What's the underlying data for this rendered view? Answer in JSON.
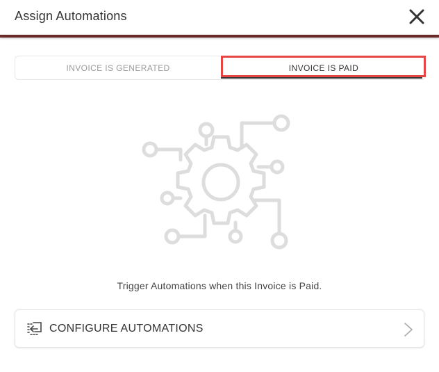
{
  "header": {
    "title": "Assign Automations",
    "close_icon": "close-icon"
  },
  "tabs": [
    {
      "label": "INVOICE IS GENERATED",
      "active": false
    },
    {
      "label": "INVOICE IS PAID",
      "active": true
    }
  ],
  "colors": {
    "header_divider": "#6a2a2a",
    "highlight": "#e64545",
    "illustration": "#dddddd"
  },
  "illustration": {
    "icon": "automation-gear-icon"
  },
  "main": {
    "trigger_text": "Trigger Automations when this Invoice is Paid."
  },
  "configure": {
    "label": "CONFIGURE AUTOMATIONS",
    "icon": "configure-automation-icon",
    "chevron": "chevron-right-icon"
  }
}
